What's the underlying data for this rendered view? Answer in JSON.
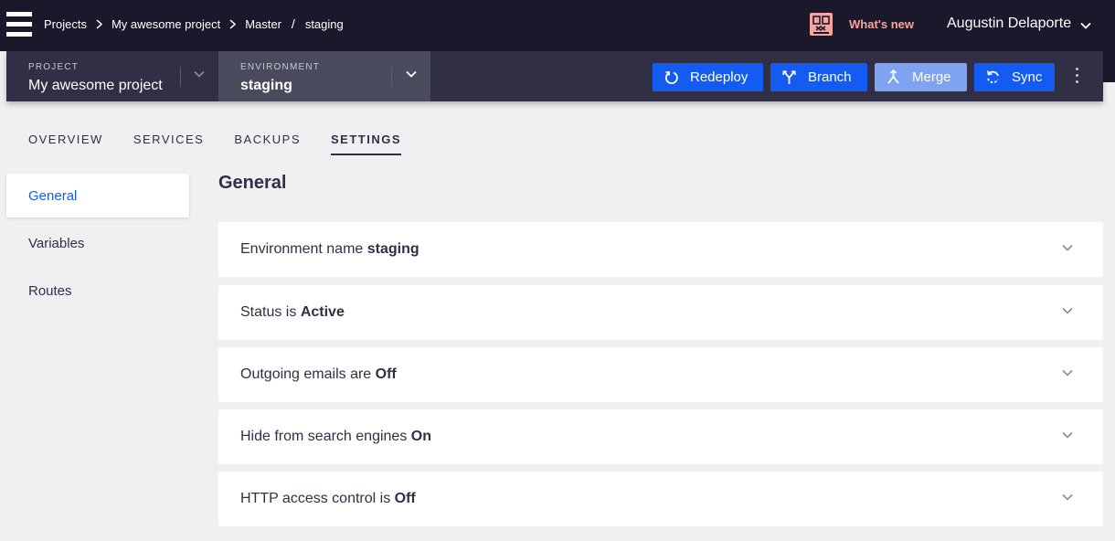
{
  "breadcrumb": {
    "items": [
      "Projects",
      "My awesome project",
      "Master",
      "staging"
    ]
  },
  "header": {
    "whats_new": "What's new",
    "user_name": "Augustin Delaporte"
  },
  "project_selector": {
    "label": "PROJECT",
    "value": "My awesome project"
  },
  "environment_selector": {
    "label": "ENVIRONMENT",
    "value": "staging"
  },
  "actions": {
    "redeploy": "Redeploy",
    "branch": "Branch",
    "merge": "Merge",
    "sync": "Sync"
  },
  "tabs": [
    "OVERVIEW",
    "SERVICES",
    "BACKUPS",
    "SETTINGS"
  ],
  "active_tab": "SETTINGS",
  "sidebar": {
    "items": [
      "General",
      "Variables",
      "Routes"
    ],
    "active": "General"
  },
  "main": {
    "title": "General",
    "panels": [
      {
        "prefix": "Environment name",
        "value": "staging"
      },
      {
        "prefix": "Status is",
        "value": "Active"
      },
      {
        "prefix": "Outgoing emails are",
        "value": "Off"
      },
      {
        "prefix": "Hide from search engines",
        "value": "On"
      },
      {
        "prefix": "HTTP access control is",
        "value": "Off"
      }
    ]
  },
  "colors": {
    "topbar": "#1a192b",
    "subbar": "#302f45",
    "accent": "#145cf1",
    "merge_disabled": "#7ea3f0",
    "whats_new": "#f4a5a2",
    "background": "#f0f0f3"
  },
  "icons": {
    "logo": "hamburger-logo-icon",
    "breadcrumb_separator": "chevron-right-icon",
    "whats_new": "gift-icon",
    "user_dropdown": "chevron-down-icon",
    "redeploy": "redeploy-icon",
    "branch": "branch-icon",
    "merge": "merge-icon",
    "sync": "sync-icon",
    "more": "kebab-menu-icon",
    "panel_expand": "chevron-down-icon"
  }
}
